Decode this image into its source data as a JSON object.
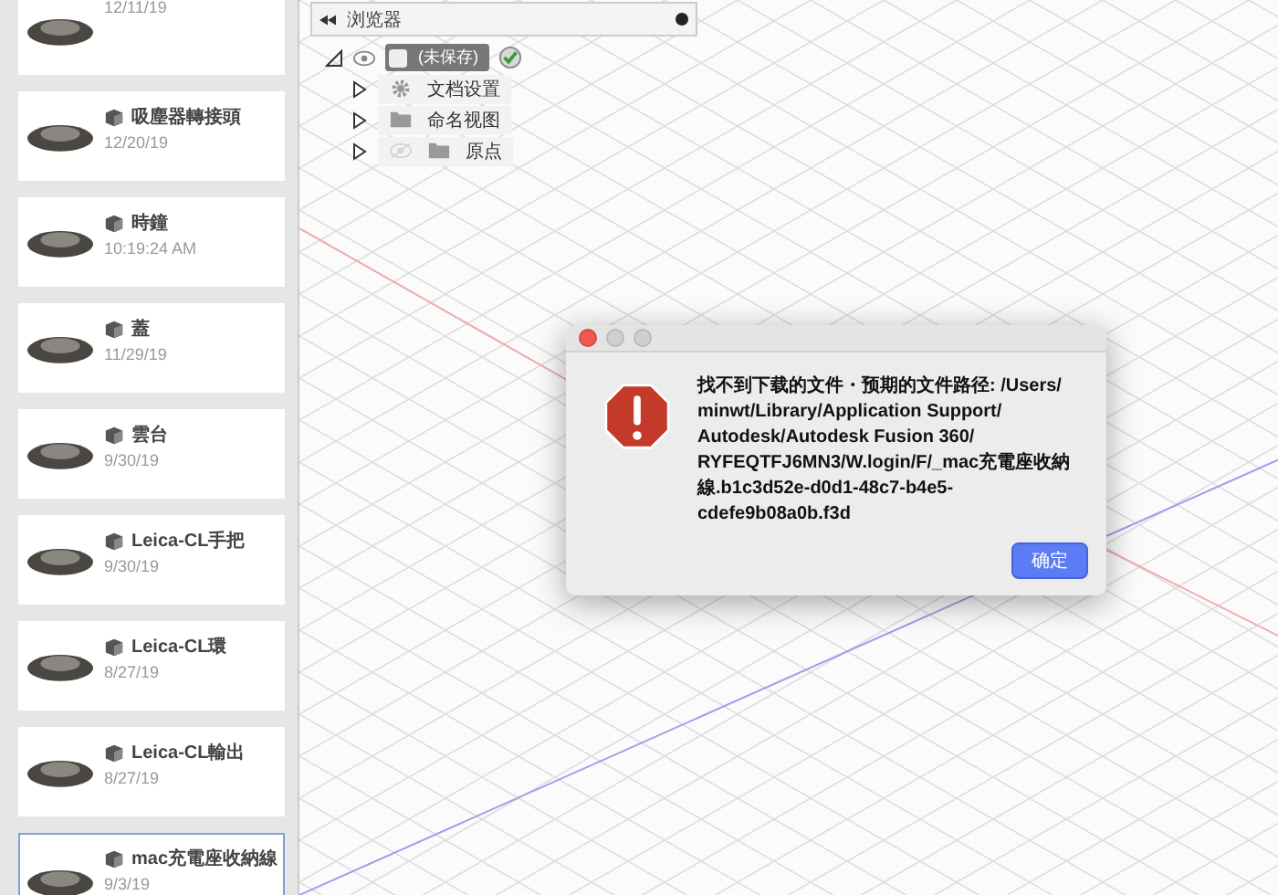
{
  "sidebar": {
    "items": [
      {
        "date": "12/11/19",
        "selected": false
      },
      {
        "name": "吸塵器轉接頭",
        "date": "12/20/19",
        "selected": false
      },
      {
        "name": "時鐘",
        "date": "10:19:24 AM",
        "selected": false
      },
      {
        "name": "蓋",
        "date": "11/29/19",
        "selected": false
      },
      {
        "name": "雲台",
        "date": "9/30/19",
        "selected": false
      },
      {
        "name": "Leica-CL手把",
        "date": "9/30/19",
        "selected": false
      },
      {
        "name": "Leica-CL環",
        "date": "8/27/19",
        "selected": false
      },
      {
        "name": "Leica-CL輸出",
        "date": "8/27/19",
        "selected": false
      },
      {
        "name": "mac充電座收納線",
        "date": "9/3/19",
        "selected": true
      }
    ]
  },
  "browser": {
    "title": "浏览器",
    "root": {
      "label": "(未保存)",
      "expanded": true,
      "children": [
        {
          "kind": "settings",
          "label": "文档设置",
          "expanded": false
        },
        {
          "kind": "folder",
          "label": "命名视图",
          "expanded": false
        },
        {
          "kind": "folder-eye",
          "label": "原点",
          "expanded": false,
          "visible": false
        }
      ]
    }
  },
  "dialog": {
    "message_lines": [
      "找不到下载的文件・预期的文件路径: /Users/",
      "minwt/Library/Application Support/",
      "Autodesk/Autodesk Fusion 360/",
      "RYFEQTFJ6MN3/W.login/F/_mac充電座收納",
      "線.b1c3d52e-d0d1-48c7-b4e5-",
      "cdefe9b08a0b.f3d"
    ],
    "button": "确定"
  }
}
